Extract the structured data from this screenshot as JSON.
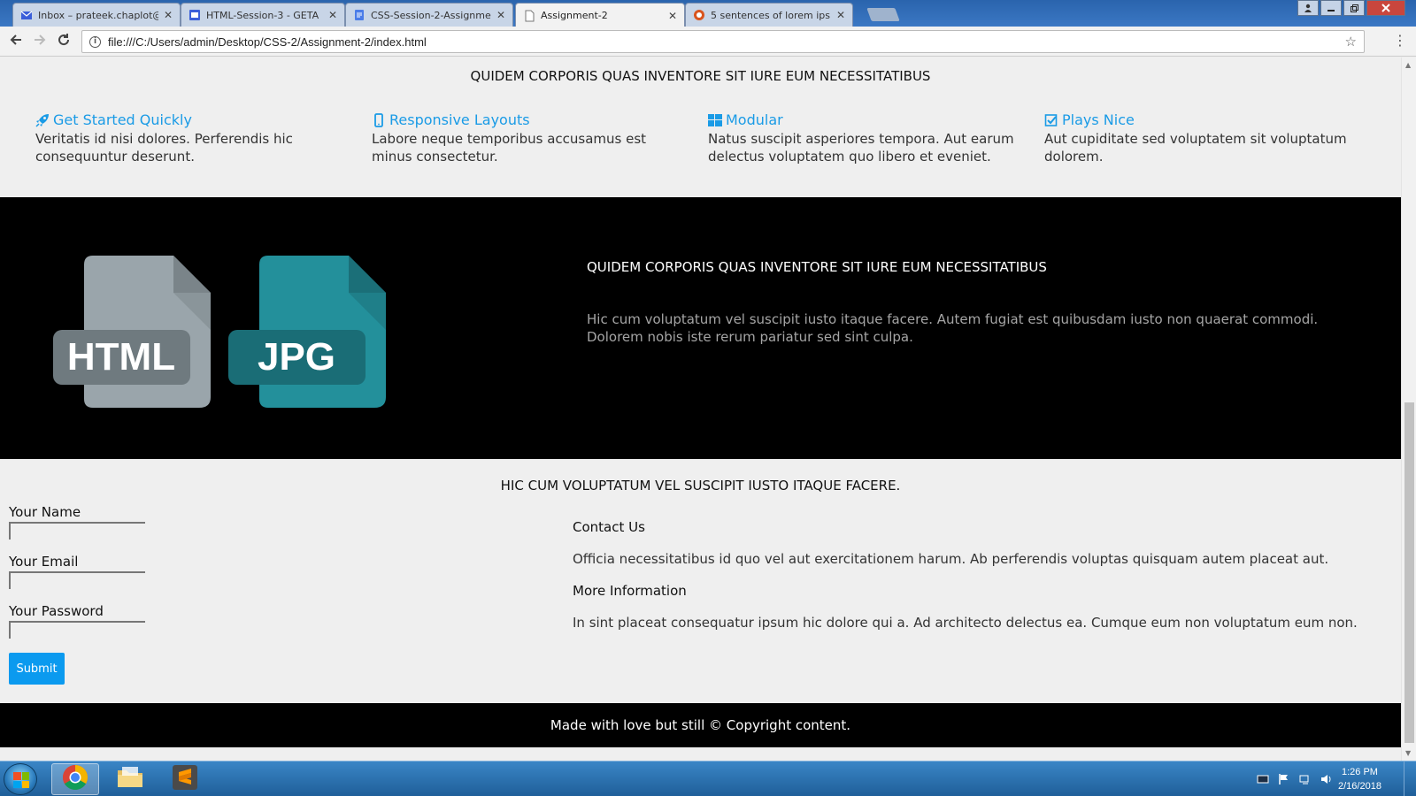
{
  "browser": {
    "tabs": [
      {
        "label": "Inbox – prateek.chaplot@",
        "active": false,
        "icon": "mail-icon",
        "color": "#3b5fd9"
      },
      {
        "label": "HTML-Session-3 - GETA",
        "active": false,
        "icon": "slides-icon",
        "color": "#3b5fd9"
      },
      {
        "label": "CSS-Session-2-Assignme",
        "active": false,
        "icon": "docs-icon",
        "color": "#4a7ce8"
      },
      {
        "label": "Assignment-2",
        "active": true,
        "icon": "page-icon",
        "color": "#777777"
      },
      {
        "label": "5 sentences of lorem ips",
        "active": false,
        "icon": "lorem-icon",
        "color": "#d9541e"
      }
    ],
    "close_glyph": "✕",
    "url": "file:///C:/Users/admin/Desktop/CSS-2/Assignment-2/index.html"
  },
  "features": {
    "title": "QUIDEM CORPORIS QUAS INVENTORE SIT IURE EUM NECESSITATIBUS",
    "items": [
      {
        "title": "Get Started Quickly",
        "icon": "rocket-icon",
        "text": "Veritatis id nisi dolores. Perferendis hic consequuntur deserunt."
      },
      {
        "title": "Responsive Layouts",
        "icon": "mobile-icon",
        "text": "Labore neque temporibus accusamus est minus consectetur."
      },
      {
        "title": "Modular",
        "icon": "grid-icon",
        "text": "Natus suscipit asperiores tempora. Aut earum delectus voluptatem quo libero et eveniet."
      },
      {
        "title": "Plays Nice",
        "icon": "check-square-icon",
        "text": "Aut cupiditate sed voluptatem sit voluptatum dolorem."
      }
    ],
    "accent": "#1a9be6"
  },
  "band": {
    "file_icons": [
      {
        "label": "HTML",
        "color": "#9aa5ab",
        "fold": "#7a8489",
        "tag": "#6f7a7f"
      },
      {
        "label": "JPG",
        "color": "#23909b",
        "fold": "#1b6f78",
        "tag": "#1a6d76"
      }
    ],
    "heading": "QUIDEM CORPORIS QUAS INVENTORE SIT IURE EUM NECESSITATIBUS",
    "text": "Hic cum voluptatum vel suscipit iusto itaque facere. Autem fugiat est quibusdam iusto non quaerat commodi. Dolorem nobis iste rerum pariatur sed sint culpa."
  },
  "contact": {
    "title": "HIC CUM VOLUPTATUM VEL SUSCIPIT IUSTO ITAQUE FACERE.",
    "form": {
      "name_label": "Your Name",
      "email_label": "Your Email",
      "password_label": "Your Password",
      "submit_label": "Submit"
    },
    "info": {
      "contact_heading": "Contact Us",
      "contact_text": "Officia necessitatibus id quo vel aut exercitationem harum. Ab perferendis voluptas quisquam autem placeat aut.",
      "more_heading": "More Information",
      "more_text": "In sint placeat consequatur ipsum hic dolore qui a. Ad architecto delectus ea. Cumque eum non voluptatum eum non."
    }
  },
  "footer": {
    "text": "Made with love but still © Copyright content."
  },
  "taskbar": {
    "apps": [
      "chrome-icon",
      "folder-icon",
      "sublime-icon"
    ],
    "time": "1:26 PM",
    "date": "2/16/2018"
  }
}
